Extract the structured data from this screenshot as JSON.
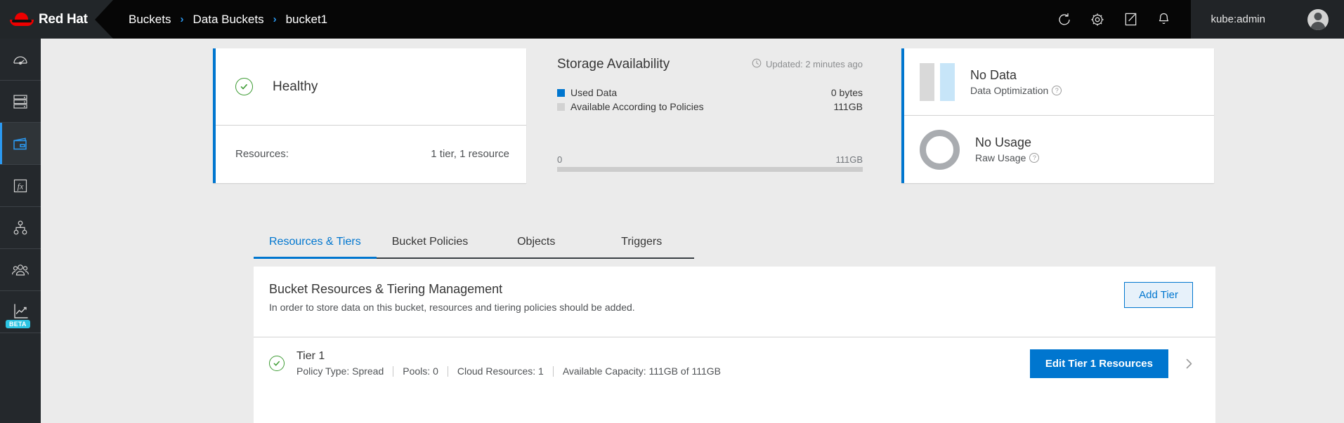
{
  "masthead": {
    "brand": "Red Hat",
    "brand_logo_icon": "red-hat-logo",
    "breadcrumb": [
      {
        "label": "Buckets",
        "separator": "›"
      },
      {
        "label": "Data Buckets",
        "separator": "›"
      },
      {
        "label": "bucket1",
        "separator": ""
      }
    ],
    "icons": [
      {
        "name": "refresh-icon",
        "title": "Refresh"
      },
      {
        "name": "gear-icon",
        "title": "Settings"
      },
      {
        "name": "edit-icon",
        "title": "Edit"
      },
      {
        "name": "bell-icon",
        "title": "Notifications"
      }
    ],
    "user": {
      "name": "kube:admin",
      "avatar_icon": "user-avatar-icon"
    }
  },
  "sidebar": {
    "items": [
      {
        "name": "dashboard",
        "icon": "gauge-icon",
        "active": false
      },
      {
        "name": "resources",
        "icon": "servers-icon",
        "active": false
      },
      {
        "name": "buckets",
        "icon": "bucket-icon",
        "active": true
      },
      {
        "name": "functions",
        "icon": "fx-icon",
        "active": false
      },
      {
        "name": "namespaces",
        "icon": "hierarchy-icon",
        "active": false
      },
      {
        "name": "accounts",
        "icon": "users-icon",
        "active": false
      },
      {
        "name": "analytics",
        "icon": "analytics-icon",
        "active": false,
        "badge": "BETA"
      }
    ]
  },
  "health_card": {
    "status_icon": "check-circle-icon",
    "status": "Healthy",
    "resources_label": "Resources:",
    "resources_value": "1 tier, 1 resource",
    "accent_color": "#0076cf",
    "status_color": "#3f9c35"
  },
  "storage_card": {
    "title": "Storage Availability",
    "updated_icon": "clock-icon",
    "updated": "Updated: 2 minutes ago",
    "legend": [
      {
        "label": "Used Data",
        "value": "0 bytes",
        "color": "#0076cf"
      },
      {
        "label": "Available According to Policies",
        "value": "111GB",
        "color": "#d2d2d2"
      }
    ],
    "scale_min": "0",
    "scale_max": "111GB",
    "bar_color": "#cccccc"
  },
  "metrics_card": {
    "rows": [
      {
        "glyph": "bar-chart-glyph",
        "title": "No Data",
        "subtitle": "Data Optimization",
        "help_icon": "help-icon",
        "colors": [
          "#d9d9d9",
          "#c7e5f8"
        ]
      },
      {
        "glyph": "donut-chart-glyph",
        "title": "No Usage",
        "subtitle": "Raw Usage",
        "help_icon": "help-icon",
        "colors": [
          "#a9acb0"
        ]
      }
    ]
  },
  "tabs": [
    {
      "label": "Resources & Tiers",
      "active": true
    },
    {
      "label": "Bucket Policies",
      "active": false
    },
    {
      "label": "Objects",
      "active": false
    },
    {
      "label": "Triggers",
      "active": false
    }
  ],
  "panel": {
    "title": "Bucket Resources & Tiering Management",
    "subtitle": "In order to store data on this bucket, resources and tiering policies should be added.",
    "add_tier_label": "Add Tier",
    "tier": {
      "status_icon": "check-circle-icon",
      "name": "Tier 1",
      "meta": [
        "Policy Type: Spread",
        "Pools: 0",
        "Cloud Resources: 1",
        "Available Capacity: 111GB of 111GB"
      ],
      "edit_label": "Edit Tier 1 Resources",
      "chevron_icon": "chevron-right-icon"
    }
  }
}
